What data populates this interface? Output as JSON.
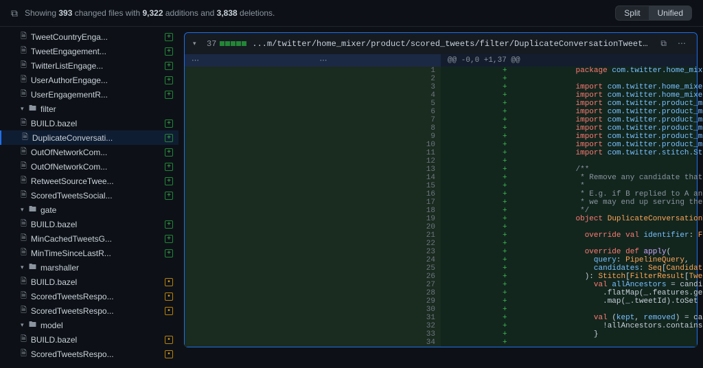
{
  "header": {
    "showing": "Showing",
    "files_count": "393",
    "files_label": "changed files",
    "with": "with",
    "additions": "9,322",
    "add_label": "additions",
    "and": "and",
    "deletions": "3,838",
    "del_label": "deletions.",
    "split": "Split",
    "unified": "Unified"
  },
  "tree": [
    {
      "type": "file",
      "depth": 2,
      "name": "TweetCountryEnga...",
      "badge": "add"
    },
    {
      "type": "file",
      "depth": 2,
      "name": "TweetEngagement...",
      "badge": "add"
    },
    {
      "type": "file",
      "depth": 2,
      "name": "TwitterListEngage...",
      "badge": "add"
    },
    {
      "type": "file",
      "depth": 2,
      "name": "UserAuthorEngage...",
      "badge": "add"
    },
    {
      "type": "file",
      "depth": 2,
      "name": "UserEngagementR...",
      "badge": "add"
    },
    {
      "type": "folder",
      "depth": 1,
      "name": "filter",
      "open": true
    },
    {
      "type": "file",
      "depth": 2,
      "name": "BUILD.bazel",
      "badge": "add"
    },
    {
      "type": "file",
      "depth": 2,
      "name": "DuplicateConversati...",
      "badge": "add",
      "active": true
    },
    {
      "type": "file",
      "depth": 2,
      "name": "OutOfNetworkCom...",
      "badge": "add"
    },
    {
      "type": "file",
      "depth": 2,
      "name": "OutOfNetworkCom...",
      "badge": "add"
    },
    {
      "type": "file",
      "depth": 2,
      "name": "RetweetSourceTwee...",
      "badge": "add"
    },
    {
      "type": "file",
      "depth": 2,
      "name": "ScoredTweetsSocial...",
      "badge": "add"
    },
    {
      "type": "folder",
      "depth": 1,
      "name": "gate",
      "open": true
    },
    {
      "type": "file",
      "depth": 2,
      "name": "BUILD.bazel",
      "badge": "add"
    },
    {
      "type": "file",
      "depth": 2,
      "name": "MinCachedTweetsG...",
      "badge": "add"
    },
    {
      "type": "file",
      "depth": 2,
      "name": "MinTimeSinceLastR...",
      "badge": "add"
    },
    {
      "type": "folder",
      "depth": 1,
      "name": "marshaller",
      "open": true
    },
    {
      "type": "file",
      "depth": 2,
      "name": "BUILD.bazel",
      "badge": "mod"
    },
    {
      "type": "file",
      "depth": 2,
      "name": "ScoredTweetsRespo...",
      "badge": "mod"
    },
    {
      "type": "file",
      "depth": 2,
      "name": "ScoredTweetsRespo...",
      "badge": "mod"
    },
    {
      "type": "folder",
      "depth": 1,
      "name": "model",
      "open": true
    },
    {
      "type": "file",
      "depth": 2,
      "name": "BUILD.bazel",
      "badge": "mod"
    },
    {
      "type": "file",
      "depth": 2,
      "name": "ScoredTweetsRespo...",
      "badge": "mod"
    }
  ],
  "file": {
    "count": "37",
    "path": "...m/twitter/home_mixer/product/scored_tweets/filter/DuplicateConversationTweetsFilter.scala",
    "hunk": "@@ -0,0 +1,37 @@"
  },
  "lines": [
    {
      "n": 1,
      "html": "<span class='k'>package</span> <span class='d'>com.twitter.home_mixer.product.scored_tweets.filter</span>"
    },
    {
      "n": 2,
      "html": ""
    },
    {
      "n": 3,
      "html": "<span class='k'>import</span> <span class='d'>com.twitter.home_mixer.model.HomeFeatures.AncestorsFeature</span>"
    },
    {
      "n": 4,
      "html": "<span class='k'>import</span> <span class='d'>com.twitter.home_mixer.util.CandidatesUtil</span>"
    },
    {
      "n": 5,
      "html": "<span class='k'>import</span> <span class='d'>com.twitter.product_mixer.component_library.model.candidate.TweetCandidate</span>"
    },
    {
      "n": 6,
      "html": "<span class='k'>import</span> <span class='d'>com.twitter.product_mixer.core.functional_component.filter.Filter</span>"
    },
    {
      "n": 7,
      "html": "<span class='k'>import</span> <span class='d'>com.twitter.product_mixer.core.functional_component.filter.FilterResult</span>"
    },
    {
      "n": 8,
      "html": "<span class='k'>import</span> <span class='d'>com.twitter.product_mixer.core.model.common.CandidateWithFeatures</span>"
    },
    {
      "n": 9,
      "html": "<span class='k'>import</span> <span class='d'>com.twitter.product_mixer.core.model.common.identifier.FilterIdentifier</span>"
    },
    {
      "n": 10,
      "html": "<span class='k'>import</span> <span class='d'>com.twitter.product_mixer.core.pipeline.PipelineQuery</span>"
    },
    {
      "n": 11,
      "html": "<span class='k'>import</span> <span class='d'>com.twitter.stitch.Stitch</span>"
    },
    {
      "n": 12,
      "html": ""
    },
    {
      "n": 13,
      "html": "<span class='c'>/**</span>"
    },
    {
      "n": 14,
      "html": "<span class='c'> * Remove any candidate that is in the ancestor list of any reply, including retweets of ancestors.</span>"
    },
    {
      "n": 15,
      "html": "<span class='c'> *</span>"
    },
    {
      "n": 16,
      "html": "<span class='c'> * E.g. if B replied to A and D was a retweet of A, we would prefer to drop D since otherwise</span>"
    },
    {
      "n": 17,
      "html": "<span class='c'> * we may end up serving the same tweet twice in the timeline (e.g. serving both A-&gt;B and D).</span>"
    },
    {
      "n": 18,
      "html": "<span class='c'> */</span>"
    },
    {
      "n": 19,
      "html": "<span class='k'>object</span> <span class='t'>DuplicateConversationTweetsFilter</span> <span class='k'>extends</span> <span class='t'>Filter</span>[<span class='t'>PipelineQuery</span>, <span class='t'>TweetCandidate</span>] {"
    },
    {
      "n": 20,
      "html": ""
    },
    {
      "n": 21,
      "html": "  <span class='k'>override</span> <span class='k'>val</span> <span class='d'>identifier</span>: <span class='t'>FilterIdentifier</span> = <span class='t'>FilterIdentifier</span>(<span class='s'>\"DuplicateConversationTweets\"</span>)"
    },
    {
      "n": 22,
      "html": ""
    },
    {
      "n": 23,
      "html": "  <span class='k'>override</span> <span class='k'>def</span> <span class='fn'>apply</span>("
    },
    {
      "n": 24,
      "html": "    <span class='d'>query</span>: <span class='t'>PipelineQuery</span>,"
    },
    {
      "n": 25,
      "html": "    <span class='d'>candidates</span>: <span class='t'>Seq</span>[<span class='t'>CandidateWithFeatures</span>[<span class='t'>TweetCandidate</span>]]"
    },
    {
      "n": 26,
      "html": "  ): <span class='t'>Stitch</span>[<span class='t'>FilterResult</span>[<span class='t'>TweetCandidate</span>]] = {"
    },
    {
      "n": 27,
      "html": "    <span class='k'>val</span> <span class='d'>allAncestors</span> = candidates"
    },
    {
      "n": 28,
      "html": "      .flatMap(_.features.getOrElse(<span class='t'>AncestorsFeature</span>, <span class='t'>Seq</span>.empty))"
    },
    {
      "n": 29,
      "html": "      .map(_.tweetId).toSet"
    },
    {
      "n": 30,
      "html": ""
    },
    {
      "n": 31,
      "html": "    <span class='k'>val</span> (<span class='d'>kept</span>, <span class='d'>removed</span>) = candidates.partition { candidate =&gt;"
    },
    {
      "n": 32,
      "html": "      !allAncestors.contains(<span class='t'>CandidatesUtil</span>.getOriginalTweetId(candidate))"
    },
    {
      "n": 33,
      "html": "    }"
    },
    {
      "n": 34,
      "html": ""
    }
  ]
}
